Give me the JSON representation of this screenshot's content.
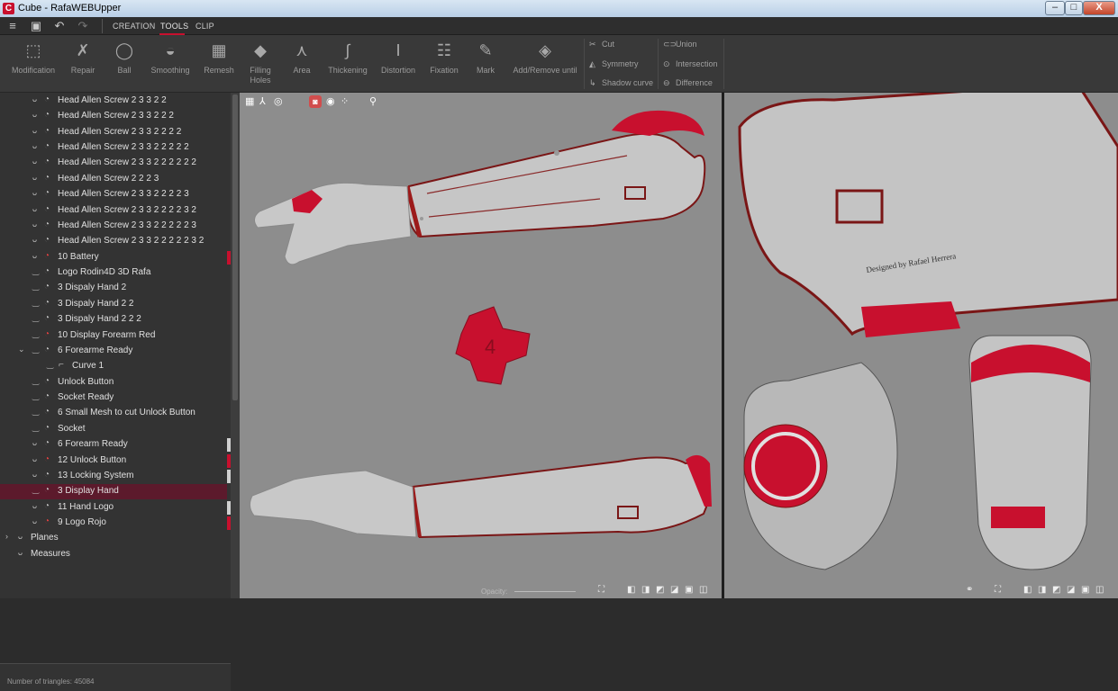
{
  "window": {
    "title": "Cube - RafaWEBUpper",
    "logo": "C",
    "min": "–",
    "max": "□",
    "close": "X"
  },
  "menubar": {
    "tabs": [
      "CREATION",
      "TOOLS",
      "CLIP"
    ],
    "active_tab": "TOOLS"
  },
  "toolbar": {
    "tools": [
      {
        "label": "Modification",
        "icon": "modification-icon",
        "glyph": "⬚"
      },
      {
        "label": "Repair",
        "icon": "repair-icon",
        "glyph": "✗"
      },
      {
        "label": "Ball",
        "icon": "ball-icon",
        "glyph": "◯"
      },
      {
        "label": "Smoothing",
        "icon": "smoothing-icon",
        "glyph": "◒"
      },
      {
        "label": "Remesh",
        "icon": "remesh-icon",
        "glyph": "▦"
      },
      {
        "label": "Filling Holes",
        "icon": "filling-holes-icon",
        "glyph": "◆"
      },
      {
        "label": "Area",
        "icon": "area-icon",
        "glyph": "⋏"
      },
      {
        "label": "Thickening",
        "icon": "thickening-icon",
        "glyph": "∫"
      },
      {
        "label": "Distortion",
        "icon": "distortion-icon",
        "glyph": "Ⅰ"
      },
      {
        "label": "Fixation",
        "icon": "fixation-icon",
        "glyph": "☷"
      },
      {
        "label": "Mark",
        "icon": "mark-icon",
        "glyph": "✎"
      },
      {
        "label": "Add/Remove until",
        "icon": "add-remove-icon",
        "glyph": "◈"
      }
    ],
    "cut_tools": [
      {
        "label": "Cut",
        "icon": "cut-icon",
        "glyph": "✂"
      },
      {
        "label": "Symmetry",
        "icon": "symmetry-icon",
        "glyph": "◭"
      },
      {
        "label": "Shadow curve",
        "icon": "shadow-curve-icon",
        "glyph": "↳"
      }
    ],
    "boolean_tools": [
      {
        "label": "Union",
        "icon": "union-icon",
        "glyph": "⊂⊃"
      },
      {
        "label": "Intersection",
        "icon": "intersection-icon",
        "glyph": "⊙"
      },
      {
        "label": "Difference",
        "icon": "difference-icon",
        "glyph": "⊖"
      }
    ]
  },
  "tree": {
    "items": [
      {
        "name": "Head Allen Screw 2 3 3 2 2",
        "indent": 1,
        "vis": "ᴗ",
        "red": false
      },
      {
        "name": "Head Allen Screw 2 3 3 2 2 2",
        "indent": 1,
        "vis": "ᴗ",
        "red": false
      },
      {
        "name": "Head Allen Screw 2 3 3 2 2 2 2",
        "indent": 1,
        "vis": "ᴗ",
        "red": false
      },
      {
        "name": "Head Allen Screw 2 3 3 2 2 2 2 2",
        "indent": 1,
        "vis": "ᴗ",
        "red": false
      },
      {
        "name": "Head Allen Screw 2 3 3 2 2 2 2 2 2",
        "indent": 1,
        "vis": "ᴗ",
        "red": false
      },
      {
        "name": "Head Allen Screw 2 2 2 3",
        "indent": 1,
        "vis": "ᴗ",
        "red": false
      },
      {
        "name": "Head Allen Screw 2 3 3 2 2 2 2 3",
        "indent": 1,
        "vis": "ᴗ",
        "red": false
      },
      {
        "name": "Head Allen Screw 2 3 3 2 2 2 2 3 2",
        "indent": 1,
        "vis": "ᴗ",
        "red": false
      },
      {
        "name": "Head Allen Screw 2 3 3 2 2 2 2 2 3",
        "indent": 1,
        "vis": "ᴗ",
        "red": false
      },
      {
        "name": "Head Allen Screw 2 3 3 2 2 2 2 2 3 2",
        "indent": 1,
        "vis": "ᴗ",
        "red": false
      },
      {
        "name": "10 Battery",
        "indent": 1,
        "vis": "ᴗ",
        "red": true,
        "mark": "#c8102e"
      },
      {
        "name": "Logo Rodin4D 3D Rafa",
        "indent": 1,
        "vis": "‿",
        "red": false
      },
      {
        "name": "3 Dispaly Hand 2",
        "indent": 1,
        "vis": "‿",
        "red": false
      },
      {
        "name": "3 Dispaly Hand 2 2",
        "indent": 1,
        "vis": "‿",
        "red": false
      },
      {
        "name": "3 Dispaly Hand 2 2 2",
        "indent": 1,
        "vis": "‿",
        "red": false
      },
      {
        "name": "10 Display Forearm Red",
        "indent": 1,
        "vis": "‿",
        "red": true
      },
      {
        "name": "6 Forearme Ready",
        "indent": 1,
        "vis": "‿",
        "red": false,
        "expanded": true
      },
      {
        "name": "Curve 1",
        "indent": 2,
        "vis": "‿",
        "red": false,
        "curve": true
      },
      {
        "name": "Unlock Button",
        "indent": 1,
        "vis": "‿",
        "red": false
      },
      {
        "name": "Socket Ready",
        "indent": 1,
        "vis": "‿",
        "red": false
      },
      {
        "name": "6 Small Mesh to cut Unlock Button",
        "indent": 1,
        "vis": "‿",
        "red": false
      },
      {
        "name": "Socket",
        "indent": 1,
        "vis": "‿",
        "red": false
      },
      {
        "name": "6 Forearm Ready",
        "indent": 1,
        "vis": "ᴗ",
        "red": false,
        "mark": "#d0d0d0"
      },
      {
        "name": "12 Unlock Button",
        "indent": 1,
        "vis": "ᴗ",
        "red": true,
        "mark": "#c8102e"
      },
      {
        "name": "13 Locking System",
        "indent": 1,
        "vis": "ᴗ",
        "red": false,
        "mark": "#d0d0d0"
      },
      {
        "name": "3 Display Hand",
        "indent": 1,
        "vis": "‿",
        "red": false,
        "selected": true
      },
      {
        "name": "11 Hand Logo",
        "indent": 1,
        "vis": "ᴗ",
        "red": false,
        "mark": "#d0d0d0"
      },
      {
        "name": "9 Logo Rojo",
        "indent": 1,
        "vis": "ᴗ",
        "red": true,
        "mark": "#c8102e"
      },
      {
        "name": "Planes",
        "indent": 0,
        "vis": "ᴗ",
        "red": false,
        "group": true
      },
      {
        "name": "Measures",
        "indent": 0,
        "vis": "ᴗ",
        "red": false,
        "group": true,
        "nochev": true
      }
    ]
  },
  "status": {
    "triangles": "Number of triangles: 45084"
  },
  "viewport": {
    "opacity_label": "Opacity:",
    "engraving": "Designed by Rafael Herrera",
    "label_4": "4",
    "colors": {
      "model": "#c4c4c4",
      "accent": "#c8102e",
      "bg": "#8d8d8d"
    }
  }
}
